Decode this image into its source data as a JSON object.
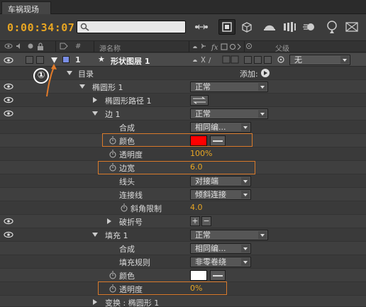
{
  "panel": {
    "tab_title": "车祸现场"
  },
  "toolbar": {
    "timecode": "0:00:34:07",
    "search_placeholder": "",
    "tools": [
      "composition-flowchart-icon",
      "comp-mini-flowchart-icon",
      "draft-3d-icon",
      "shy-layers-icon",
      "frame-blending-icon",
      "motion-blur-icon",
      "graph-editor-icon",
      "brainstorm-icon",
      "live-update-icon"
    ]
  },
  "header": {
    "hash": "#",
    "source_name": "源名称",
    "parent": "父级"
  },
  "layer": {
    "number": "1",
    "name": "形状图层 1",
    "label_color": "#7a8ee6",
    "parent_value": "无"
  },
  "annotation": {
    "marker": "①"
  },
  "rows": {
    "contents": "目录",
    "add_label": "添加:",
    "ellipse": "椭圆形 1",
    "ellipse_mode": "正常",
    "ellipse_path": "椭圆形路径 1",
    "stroke": "边 1",
    "stroke_mode": "正常",
    "composite": "合成",
    "composite_value": "相同编...",
    "color": "颜色",
    "color_value": "#ff0000",
    "opacity": "透明度",
    "opacity_value": "100%",
    "stroke_width": "边宽",
    "stroke_width_value": "6.0",
    "line_cap": "线头",
    "line_cap_value": "对接端",
    "line_join": "连接线",
    "line_join_value": "倾斜连接",
    "miter_limit": "斜角限制",
    "miter_limit_value": "4.0",
    "dashes": "破折号",
    "fill": "填充 1",
    "fill_mode": "正常",
    "fill_composite": "合成",
    "fill_composite_value": "相同编...",
    "fill_rule": "填充规则",
    "fill_rule_value": "非零卷绕",
    "fill_color": "颜色",
    "fill_color_value": "#ffffff",
    "fill_opacity": "透明度",
    "fill_opacity_value": "0%",
    "transform": "变换 : 椭圆形 1"
  }
}
